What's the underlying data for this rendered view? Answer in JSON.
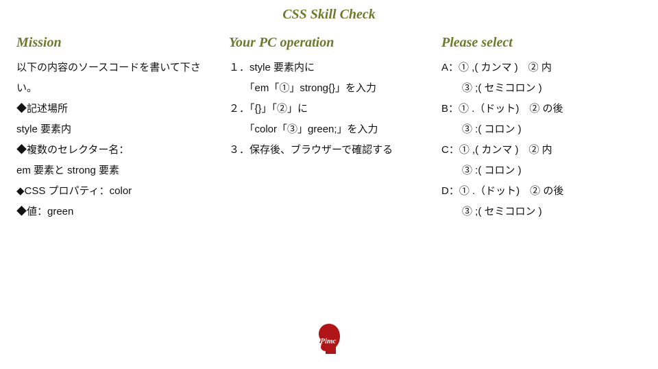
{
  "title": "CSS Skill Check",
  "mission": {
    "heading": "Mission",
    "lines": [
      "以下の内容のソースコードを書いて下さい。",
      "◆記述場所",
      "style 要素内",
      "◆複数のセレクター名：",
      "em 要素と strong 要素",
      "◆CSS プロパティ：color",
      "◆値：green"
    ]
  },
  "operation": {
    "heading": "Your PC operation",
    "lines": [
      "１．style 要素内に",
      "　　「em「①」strong{}」を入力",
      "２．「{}」「②」に",
      "　　「color「③」green;」を入力",
      "３．保存後、ブラウザーで確認する"
    ]
  },
  "select": {
    "heading": "Please select",
    "lines": [
      "A：① ,( カンマ )　② 内",
      "　　③ ;( セミコロン )",
      "B：① .（ドット)　② の後",
      "　　③ :( コロン )",
      "C：① ,( カンマ )　② 内",
      "　　③ :( コロン )",
      "D：① .（ドット)　② の後",
      "　　③ ;( セミコロン )"
    ]
  },
  "logo_label": "Pimc"
}
